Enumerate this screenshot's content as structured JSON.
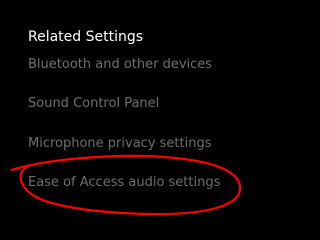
{
  "related_settings": {
    "heading": "Related Settings",
    "links": [
      {
        "label": "Bluetooth and other devices"
      },
      {
        "label": "Sound Control Panel"
      },
      {
        "label": "Microphone privacy settings"
      },
      {
        "label": "Ease of Access audio settings"
      }
    ]
  },
  "colors": {
    "background": "#000000",
    "heading_text": "#ffffff",
    "link_text": "#6f6f6f",
    "annotation": "#ff0000"
  }
}
